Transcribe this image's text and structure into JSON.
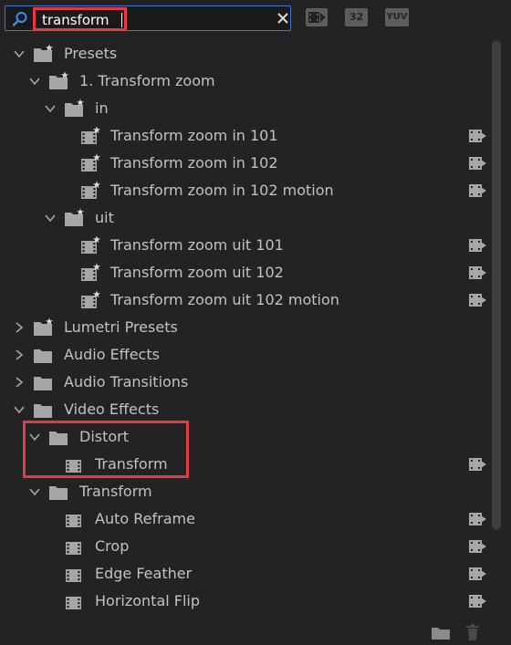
{
  "search": {
    "value": "transform"
  },
  "toolbar": {
    "accelerated_label": "",
    "bit32_label": "32",
    "yuv_label": "YUV"
  },
  "tree": {
    "rows": [
      {
        "label": "Presets",
        "type": "preset-folder",
        "level": 0,
        "state": "expanded"
      },
      {
        "label": "1. Transform zoom",
        "type": "preset-folder",
        "level": 1,
        "state": "expanded"
      },
      {
        "label": "in",
        "type": "preset-folder",
        "level": 2,
        "state": "expanded"
      },
      {
        "label": "Transform zoom in 101",
        "type": "preset",
        "level": 3,
        "accelerated": true
      },
      {
        "label": "Transform zoom in 102",
        "type": "preset",
        "level": 3,
        "accelerated": true
      },
      {
        "label": "Transform zoom in 102 motion",
        "type": "preset",
        "level": 3,
        "accelerated": true
      },
      {
        "label": "uit",
        "type": "preset-folder",
        "level": 2,
        "state": "expanded"
      },
      {
        "label": "Transform zoom uit 101",
        "type": "preset",
        "level": 3,
        "accelerated": true
      },
      {
        "label": "Transform zoom uit 102",
        "type": "preset",
        "level": 3,
        "accelerated": true
      },
      {
        "label": "Transform zoom uit 102 motion",
        "type": "preset",
        "level": 3,
        "accelerated": true
      },
      {
        "label": "Lumetri Presets",
        "type": "preset-folder",
        "level": 0,
        "state": "collapsed"
      },
      {
        "label": "Audio Effects",
        "type": "folder",
        "level": 0,
        "state": "collapsed"
      },
      {
        "label": "Audio Transitions",
        "type": "folder",
        "level": 0,
        "state": "collapsed"
      },
      {
        "label": "Video Effects",
        "type": "folder",
        "level": 0,
        "state": "expanded"
      },
      {
        "label": "Distort",
        "type": "folder",
        "level": 1,
        "state": "expanded"
      },
      {
        "label": "Transform",
        "type": "effect",
        "level": 2,
        "accelerated": true
      },
      {
        "label": "Transform",
        "type": "folder",
        "level": 1,
        "state": "expanded"
      },
      {
        "label": "Auto Reframe",
        "type": "effect",
        "level": 2,
        "accelerated": true
      },
      {
        "label": "Crop",
        "type": "effect",
        "level": 2,
        "accelerated": true
      },
      {
        "label": "Edge Feather",
        "type": "effect",
        "level": 2,
        "accelerated": true
      },
      {
        "label": "Horizontal Flip",
        "type": "effect",
        "level": 2,
        "accelerated": true
      }
    ]
  },
  "icons": {
    "search": "search-icon",
    "clear": "clear-icon",
    "new_bin": "new-bin-icon",
    "delete": "trash-icon",
    "accelerated": "accelerated-effect-icon",
    "folder": "folder-icon",
    "preset_folder": "preset-folder-icon",
    "preset": "preset-icon",
    "effect": "effect-icon"
  },
  "colors": {
    "background": "#232323",
    "search_focus": "#3c77d6",
    "highlight_box": "#e63946",
    "text": "#c2c2c2",
    "icon": "#a6a6a6"
  }
}
